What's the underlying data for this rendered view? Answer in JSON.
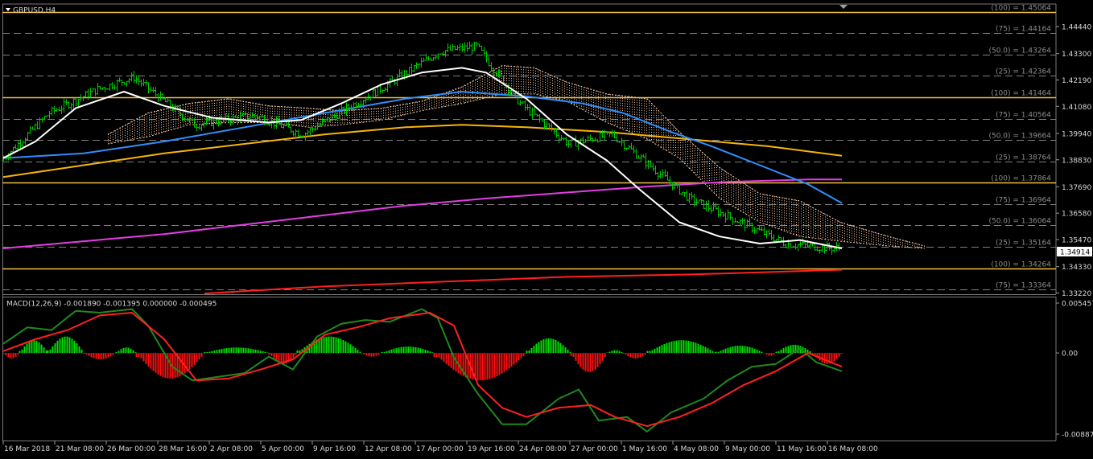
{
  "chart_data": [
    {
      "type": "line",
      "title": "GBPUSD,H4",
      "ylim": [
        1.3322,
        1.451
      ],
      "y_ticks": [
        "1.44440",
        "1.43300",
        "1.42190",
        "1.41080",
        "1.39940",
        "1.38830",
        "1.37690",
        "1.36580",
        "1.35470",
        "1.34330",
        "1.33220"
      ],
      "current_price": "1.34914",
      "x_labels": [
        "16 Mar 2018",
        "21 Mar 08:00",
        "26 Mar 00:00",
        "28 Mar 16:00",
        "2 Apr 08:00",
        "5 Apr 00:00",
        "9 Apr 16:00",
        "12 Apr 08:00",
        "17 Apr 00:00",
        "19 Apr 16:00",
        "24 Apr 08:00",
        "27 Apr 00:00",
        "1 May 16:00",
        "4 May 08:00",
        "9 May 00:00",
        "11 May 16:00",
        "16 May 08:00"
      ],
      "fib_levels": [
        {
          "label": "(100) = 1.45064",
          "value": 1.45064,
          "major": true
        },
        {
          "label": "(75) = 1.44164",
          "value": 1.44164
        },
        {
          "label": "(50.0) = 1.43264",
          "value": 1.43264
        },
        {
          "label": "(25) = 1.42364",
          "value": 1.42364
        },
        {
          "label": "(100) = 1.41464",
          "value": 1.41464,
          "major": true
        },
        {
          "label": "(75) = 1.40564",
          "value": 1.40564
        },
        {
          "label": "(50.0) = 1.39664",
          "value": 1.39664
        },
        {
          "label": "(25) = 1.38764",
          "value": 1.38764
        },
        {
          "label": "(100) = 1.37864",
          "value": 1.37864,
          "major": true
        },
        {
          "label": "(75) = 1.36964",
          "value": 1.36964
        },
        {
          "label": "(50.0) = 1.36064",
          "value": 1.36064
        },
        {
          "label": "(25) = 1.35164",
          "value": 1.35164
        },
        {
          "label": "(100) = 1.34264",
          "value": 1.34264,
          "major": true
        },
        {
          "label": "(75) = 1.33364",
          "value": 1.33364
        }
      ],
      "colors": {
        "bar": "#00c800",
        "ma_fast": "#ffffff",
        "ma_mid": "#2e8fff",
        "ma_slow": "#f5b50a",
        "ma_long": "#e43de6",
        "ma_longest": "#ff2020",
        "cloud": "#f4c8a8",
        "fib_major": "#f0c040",
        "fib_minor": "#808080"
      },
      "price_bars": [
        {
          "n": 20,
          "from": 1.388,
          "to": 1.408
        },
        {
          "n": 20,
          "from": 1.408,
          "to": 1.418
        },
        {
          "n": 15,
          "from": 1.418,
          "to": 1.423
        },
        {
          "n": 25,
          "from": 1.423,
          "to": 1.403
        },
        {
          "n": 25,
          "from": 1.403,
          "to": 1.407
        },
        {
          "n": 20,
          "from": 1.407,
          "to": 1.399
        },
        {
          "n": 35,
          "from": 1.399,
          "to": 1.42
        },
        {
          "n": 22,
          "from": 1.42,
          "to": 1.434
        },
        {
          "n": 15,
          "from": 1.434,
          "to": 1.436
        },
        {
          "n": 18,
          "from": 1.436,
          "to": 1.412
        },
        {
          "n": 20,
          "from": 1.412,
          "to": 1.395
        },
        {
          "n": 18,
          "from": 1.395,
          "to": 1.399
        },
        {
          "n": 12,
          "from": 1.399,
          "to": 1.389
        },
        {
          "n": 20,
          "from": 1.389,
          "to": 1.372
        },
        {
          "n": 15,
          "from": 1.372,
          "to": 1.365
        },
        {
          "n": 25,
          "from": 1.365,
          "to": 1.353
        },
        {
          "n": 20,
          "from": 1.353,
          "to": 1.351
        },
        {
          "n": 15,
          "from": 1.351,
          "to": 1.353
        },
        {
          "n": 16,
          "from": 1.353,
          "to": 1.349
        }
      ],
      "ma_fast": [
        [
          0,
          1.389
        ],
        [
          40,
          1.396
        ],
        [
          90,
          1.41
        ],
        [
          150,
          1.417
        ],
        [
          200,
          1.411
        ],
        [
          260,
          1.406
        ],
        [
          330,
          1.404
        ],
        [
          370,
          1.405
        ],
        [
          420,
          1.412
        ],
        [
          470,
          1.42
        ],
        [
          520,
          1.425
        ],
        [
          570,
          1.427
        ],
        [
          600,
          1.425
        ],
        [
          650,
          1.414
        ],
        [
          700,
          1.399
        ],
        [
          750,
          1.388
        ],
        [
          790,
          1.376
        ],
        [
          840,
          1.362
        ],
        [
          890,
          1.356
        ],
        [
          940,
          1.353
        ],
        [
          990,
          1.3545
        ],
        [
          1042,
          1.351
        ]
      ],
      "ma_mid": [
        [
          0,
          1.389
        ],
        [
          100,
          1.391
        ],
        [
          200,
          1.396
        ],
        [
          300,
          1.402
        ],
        [
          400,
          1.408
        ],
        [
          500,
          1.414
        ],
        [
          570,
          1.417
        ],
        [
          650,
          1.415
        ],
        [
          720,
          1.412
        ],
        [
          770,
          1.408
        ],
        [
          830,
          1.4
        ],
        [
          880,
          1.394
        ],
        [
          940,
          1.386
        ],
        [
          1000,
          1.378
        ],
        [
          1042,
          1.37
        ]
      ],
      "ma_slow": [
        [
          0,
          1.381
        ],
        [
          100,
          1.386
        ],
        [
          200,
          1.391
        ],
        [
          300,
          1.395
        ],
        [
          400,
          1.399
        ],
        [
          500,
          1.402
        ],
        [
          570,
          1.403
        ],
        [
          650,
          1.402
        ],
        [
          750,
          1.4
        ],
        [
          850,
          1.397
        ],
        [
          950,
          1.394
        ],
        [
          1042,
          1.39
        ]
      ],
      "ma_long": [
        [
          0,
          1.351
        ],
        [
          100,
          1.354
        ],
        [
          200,
          1.357
        ],
        [
          300,
          1.361
        ],
        [
          400,
          1.365
        ],
        [
          500,
          1.369
        ],
        [
          600,
          1.372
        ],
        [
          700,
          1.3745
        ],
        [
          800,
          1.377
        ],
        [
          900,
          1.379
        ],
        [
          1000,
          1.38
        ],
        [
          1042,
          1.38
        ]
      ],
      "ma_longest": [
        [
          250,
          1.332
        ],
        [
          400,
          1.335
        ],
        [
          550,
          1.337
        ],
        [
          700,
          1.339
        ],
        [
          850,
          1.34
        ],
        [
          950,
          1.341
        ],
        [
          1042,
          1.342
        ]
      ],
      "cloud": {
        "upper": [
          [
            130,
            1.399
          ],
          [
            180,
            1.408
          ],
          [
            230,
            1.412
          ],
          [
            280,
            1.414
          ],
          [
            330,
            1.411
          ],
          [
            380,
            1.41
          ],
          [
            420,
            1.409
          ],
          [
            470,
            1.41
          ],
          [
            520,
            1.413
          ],
          [
            570,
            1.419
          ],
          [
            620,
            1.428
          ],
          [
            660,
            1.427
          ],
          [
            700,
            1.421
          ],
          [
            750,
            1.416
          ],
          [
            800,
            1.414
          ],
          [
            840,
            1.4
          ],
          [
            890,
            1.385
          ],
          [
            940,
            1.374
          ],
          [
            990,
            1.371
          ],
          [
            1040,
            1.362
          ],
          [
            1100,
            1.356
          ],
          [
            1145,
            1.352
          ]
        ],
        "lower": [
          [
            130,
            1.395
          ],
          [
            180,
            1.398
          ],
          [
            230,
            1.403
          ],
          [
            280,
            1.404
          ],
          [
            330,
            1.404
          ],
          [
            380,
            1.402
          ],
          [
            420,
            1.403
          ],
          [
            470,
            1.405
          ],
          [
            520,
            1.409
          ],
          [
            570,
            1.412
          ],
          [
            620,
            1.416
          ],
          [
            660,
            1.416
          ],
          [
            700,
            1.413
          ],
          [
            750,
            1.404
          ],
          [
            800,
            1.397
          ],
          [
            840,
            1.389
          ],
          [
            890,
            1.372
          ],
          [
            940,
            1.362
          ],
          [
            990,
            1.356
          ],
          [
            1040,
            1.354
          ],
          [
            1100,
            1.352
          ],
          [
            1145,
            1.351
          ]
        ]
      }
    },
    {
      "type": "bar",
      "title": "MACD(12,26,9) -0.001890 -0.001395 0.000000 -0.000495",
      "ylim": [
        -0.00887,
        0.005457
      ],
      "y_ticks": [
        "0.005457",
        "0.00",
        "-0.00887"
      ],
      "hist_positive_color": "#00e000",
      "hist_negative_color": "#ff1010",
      "macd_line_color": "#1e8a1e",
      "signal_line_color": "#ff2020",
      "hist_segments": [
        {
          "from": 0,
          "to": 20,
          "peak": -0.0006
        },
        {
          "from": 20,
          "to": 55,
          "peak": 0.0014
        },
        {
          "from": 55,
          "to": 100,
          "peak": 0.0018
        },
        {
          "from": 100,
          "to": 140,
          "peak": -0.0007
        },
        {
          "from": 140,
          "to": 165,
          "peak": 0.0006
        },
        {
          "from": 165,
          "to": 250,
          "peak": -0.0028
        },
        {
          "from": 250,
          "to": 330,
          "peak": 0.0006
        },
        {
          "from": 330,
          "to": 365,
          "peak": -0.0012
        },
        {
          "from": 365,
          "to": 445,
          "peak": 0.0018
        },
        {
          "from": 445,
          "to": 470,
          "peak": -0.0004
        },
        {
          "from": 470,
          "to": 535,
          "peak": 0.0007
        },
        {
          "from": 535,
          "to": 650,
          "peak": -0.003
        },
        {
          "from": 650,
          "to": 705,
          "peak": 0.0016
        },
        {
          "from": 705,
          "to": 750,
          "peak": -0.0021
        },
        {
          "from": 750,
          "to": 770,
          "peak": 0.0003
        },
        {
          "from": 770,
          "to": 800,
          "peak": -0.0006
        },
        {
          "from": 800,
          "to": 885,
          "peak": 0.0014
        },
        {
          "from": 885,
          "to": 945,
          "peak": 0.0008
        },
        {
          "from": 945,
          "to": 960,
          "peak": -0.0003
        },
        {
          "from": 960,
          "to": 1005,
          "peak": 0.0009
        },
        {
          "from": 1005,
          "to": 1042,
          "peak": -0.0012
        }
      ],
      "macd_line": [
        [
          0,
          0.001
        ],
        [
          30,
          0.0028
        ],
        [
          60,
          0.0025
        ],
        [
          90,
          0.0046
        ],
        [
          120,
          0.0044
        ],
        [
          160,
          0.0048
        ],
        [
          180,
          0.003
        ],
        [
          210,
          -0.0015
        ],
        [
          235,
          -0.003
        ],
        [
          260,
          -0.0027
        ],
        [
          300,
          -0.0022
        ],
        [
          330,
          -0.0004
        ],
        [
          360,
          -0.0018
        ],
        [
          390,
          0.0018
        ],
        [
          420,
          0.0032
        ],
        [
          450,
          0.0036
        ],
        [
          480,
          0.0034
        ],
        [
          520,
          0.0048
        ],
        [
          540,
          0.0038
        ],
        [
          560,
          -0.0005
        ],
        [
          590,
          -0.0045
        ],
        [
          620,
          -0.0078
        ],
        [
          650,
          -0.0078
        ],
        [
          690,
          -0.005
        ],
        [
          715,
          -0.004
        ],
        [
          740,
          -0.0074
        ],
        [
          775,
          -0.007
        ],
        [
          800,
          -0.0086
        ],
        [
          830,
          -0.0065
        ],
        [
          870,
          -0.005
        ],
        [
          900,
          -0.003
        ],
        [
          930,
          -0.0015
        ],
        [
          960,
          -0.0012
        ],
        [
          990,
          0.0005
        ],
        [
          1010,
          -0.001
        ],
        [
          1042,
          -0.002
        ]
      ],
      "signal_line": [
        [
          0,
          0.0002
        ],
        [
          40,
          0.0015
        ],
        [
          80,
          0.0025
        ],
        [
          120,
          0.0041
        ],
        [
          160,
          0.0044
        ],
        [
          200,
          0.0015
        ],
        [
          240,
          -0.003
        ],
        [
          280,
          -0.0028
        ],
        [
          320,
          -0.0018
        ],
        [
          360,
          -0.0007
        ],
        [
          400,
          0.002
        ],
        [
          440,
          0.0028
        ],
        [
          480,
          0.0038
        ],
        [
          530,
          0.0044
        ],
        [
          560,
          0.003
        ],
        [
          590,
          -0.0035
        ],
        [
          620,
          -0.006
        ],
        [
          650,
          -0.007
        ],
        [
          690,
          -0.006
        ],
        [
          730,
          -0.0057
        ],
        [
          760,
          -0.007
        ],
        [
          800,
          -0.008
        ],
        [
          840,
          -0.007
        ],
        [
          880,
          -0.0055
        ],
        [
          920,
          -0.0035
        ],
        [
          960,
          -0.002
        ],
        [
          1000,
          0.0
        ],
        [
          1042,
          -0.0015
        ]
      ]
    }
  ]
}
